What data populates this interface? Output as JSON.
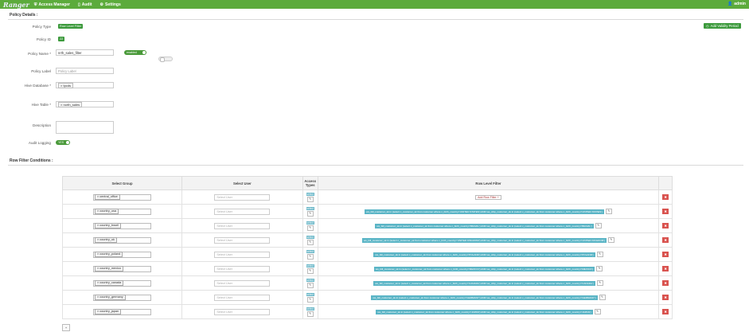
{
  "topbar": {
    "brand": "Ranger",
    "nav": [
      {
        "icon": "shield-icon",
        "glyph": "⛨",
        "label": "Access Manager"
      },
      {
        "icon": "file-icon",
        "glyph": "▯",
        "label": "Audit"
      },
      {
        "icon": "gear-icon",
        "glyph": "⚙",
        "label": "Settings"
      }
    ],
    "user": {
      "icon": "users-icon",
      "glyph": "👤",
      "label": "admin"
    }
  },
  "policy_details": {
    "section_title": "Policy Details :",
    "add_validity_button": "Add Validity Period",
    "policy_type_label": "Policy Type",
    "policy_type_value": "Row Level Filter",
    "policy_id_label": "Policy ID",
    "policy_id_value": "22",
    "policy_name_label": "Policy Name *",
    "policy_name_value": "nrth_sales_filter",
    "enabled_toggle": "enabled",
    "override_toggle": "",
    "policy_label_label": "Policy Label",
    "policy_label_placeholder": "Policy Label",
    "hive_database_label": "Hive Database *",
    "hive_database_value": "tpcds",
    "hive_table_label": "Hive Table *",
    "hive_table_value": "north_sales",
    "description_label": "Description",
    "audit_logging_label": "Audit Logging",
    "audit_logging_toggle": "YES"
  },
  "row_filter": {
    "section_title": "Row Filter Conditions :",
    "headers": {
      "group": "Select Group",
      "user": "Select User",
      "access": "Access Types",
      "filter": "Row Level Filter"
    },
    "user_placeholder": "Select User",
    "access_label": "select",
    "add_row_filter_label": "Add Row Filter",
    "rows": [
      {
        "group": "central_office",
        "filter": ""
      },
      {
        "group": "country_usa",
        "filter": "ws_bill_customer_sk in (select c_customer_sk from customer where c_birth_country='UNITED STATES') AND ws_ship_customer_sk in (select c_customer_sk from customer where c_birth_country='UNITED STATES')"
      },
      {
        "group": "country_brazil",
        "filter": "ws_bill_customer_sk in (select c_customer_sk from customer where c_birth_country='BRAZIL') AND ws_ship_customer_sk in (select c_customer_sk from customer where c_birth_country='BRAZIL')"
      },
      {
        "group": "country_uk",
        "filter": "ws_bill_customer_sk in (select c_customer_sk from customer where c_birth_country='UNITED KINGDOM') AND ws_ship_customer_sk in (select c_customer_sk from customer where c_birth_country='UNITED KINGDOM')"
      },
      {
        "group": "country_poland",
        "filter": "ws_bill_customer_sk in (select c_customer_sk from customer where c_birth_country='POLAND') AND ws_ship_customer_sk in (select c_customer_sk from customer where c_birth_country='POLAND')"
      },
      {
        "group": "country_mexico",
        "filter": "ws_bill_customer_sk in (select c_customer_sk from customer where c_birth_country='MEXICO') AND ws_ship_customer_sk in (select c_customer_sk from customer where c_birth_country='MEXICO')"
      },
      {
        "group": "country_canada",
        "filter": "ws_bill_customer_sk in (select c_customer_sk from customer where c_birth_country='CANADA') AND ws_ship_customer_sk in (select c_customer_sk from customer where c_birth_country='CANADA')"
      },
      {
        "group": "country_germany",
        "filter": "ws_bill_customer_sk in (select c_customer_sk from customer where c_birth_country='GERMANY') AND ws_ship_customer_sk in (select c_customer_sk from customer where c_birth_country='GERMANY')"
      },
      {
        "group": "country_japan",
        "filter": "ws_bill_customer_sk in (select c_customer_sk from customer where c_birth_country='JAPAN') AND ws_ship_customer_sk in (select c_customer_sk from customer where c_birth_country='JAPAN')"
      }
    ]
  },
  "colors": {
    "brand_green": "#5cab3c",
    "delete_red": "#d9534f",
    "filter_teal": "#5bb5c6"
  }
}
